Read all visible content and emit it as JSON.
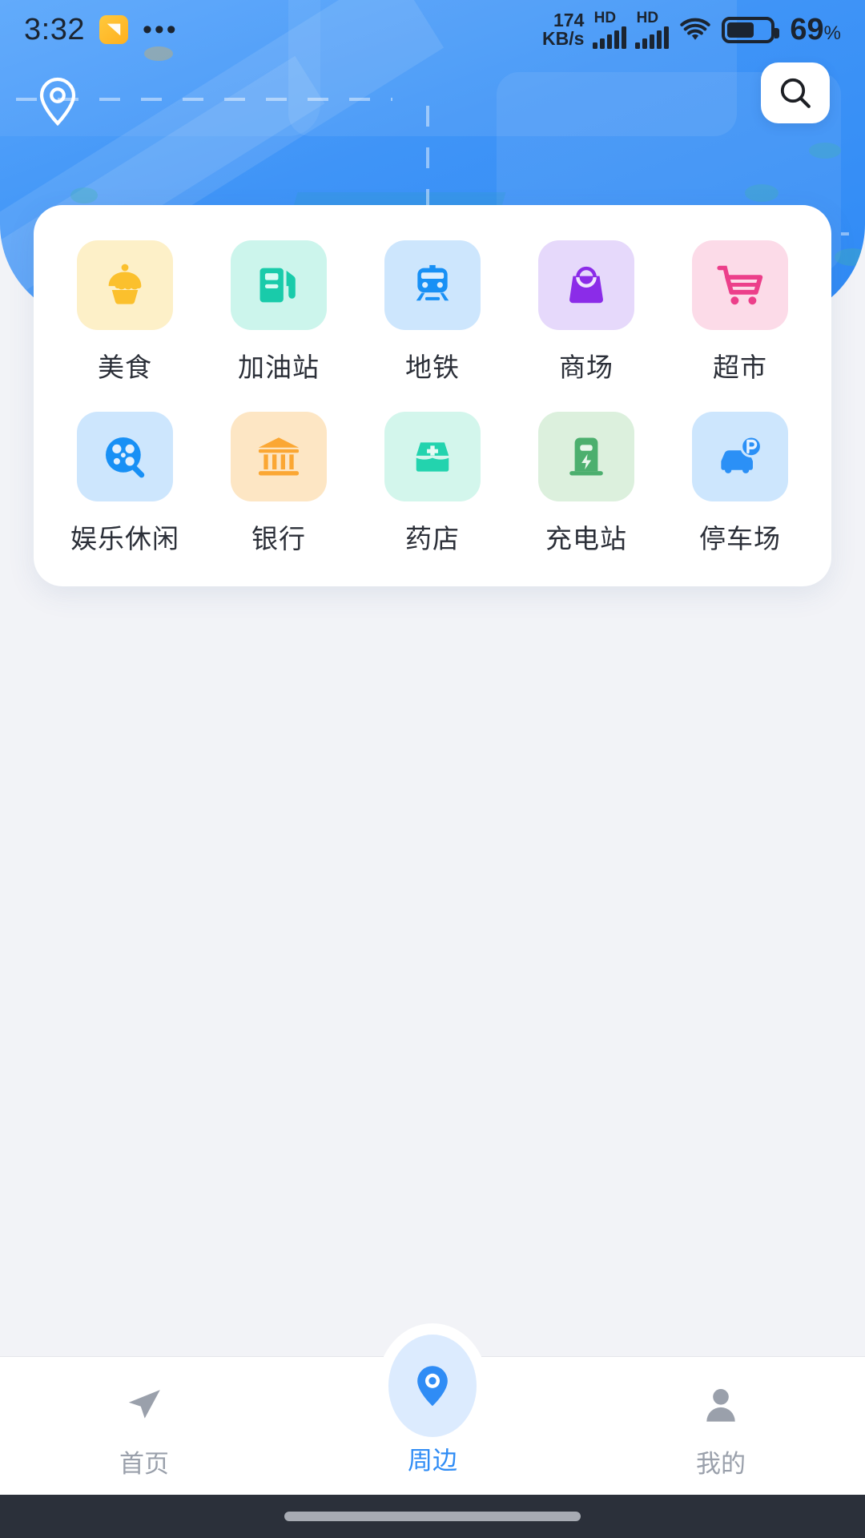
{
  "status_bar": {
    "time": "3:32",
    "app_icon": "message-icon",
    "overflow": "•••",
    "net_speed_value": "174",
    "net_speed_unit": "KB/s",
    "sim1_label": "HD",
    "sim2_label": "HD",
    "wifi": "wifi-icon",
    "battery_percent": "69",
    "battery_percent_symbol": "%",
    "battery_level": 69
  },
  "hero": {
    "location_icon": "location-pin-icon",
    "search_icon": "search-icon",
    "background": "map-illustration",
    "accent": "#3f94f7"
  },
  "categories": [
    {
      "label": "美食",
      "icon": "cupcake-icon",
      "tile_bg": "#fdf0c8",
      "icon_color": "#fbc02d"
    },
    {
      "label": "加油站",
      "icon": "fuel-pump-icon",
      "tile_bg": "#ccf5ec",
      "icon_color": "#19cbaa"
    },
    {
      "label": "地铁",
      "icon": "subway-train-icon",
      "tile_bg": "#cde6fd",
      "icon_color": "#1890f5"
    },
    {
      "label": "商场",
      "icon": "handbag-icon",
      "tile_bg": "#e6d9fb",
      "icon_color": "#8b2ce8"
    },
    {
      "label": "超市",
      "icon": "shopping-cart-icon",
      "tile_bg": "#fcdbe8",
      "icon_color": "#ec3f8a"
    },
    {
      "label": "娱乐休闲",
      "icon": "film-reel-icon",
      "tile_bg": "#cde6fd",
      "icon_color": "#1890f5"
    },
    {
      "label": "银行",
      "icon": "bank-icon",
      "tile_bg": "#fde6c4",
      "icon_color": "#fba733"
    },
    {
      "label": "药店",
      "icon": "medicine-box-icon",
      "tile_bg": "#d3f6ec",
      "icon_color": "#23d3ae"
    },
    {
      "label": "充电站",
      "icon": "charging-station-icon",
      "tile_bg": "#dcf0dd",
      "icon_color": "#4caf6e"
    },
    {
      "label": "停车场",
      "icon": "parking-car-icon",
      "tile_bg": "#cde6fd",
      "icon_color": "#2b90f6"
    }
  ],
  "tabbar": {
    "items": [
      {
        "label": "首页",
        "icon": "navigation-arrow-icon",
        "active": false
      },
      {
        "label": "周边",
        "icon": "location-pin-icon",
        "active": true
      },
      {
        "label": "我的",
        "icon": "person-icon",
        "active": false
      }
    ],
    "active_color": "#2f8cf5",
    "inactive_color": "#9aa0ab"
  },
  "gesture_bar": {
    "pill": "home-indicator"
  }
}
